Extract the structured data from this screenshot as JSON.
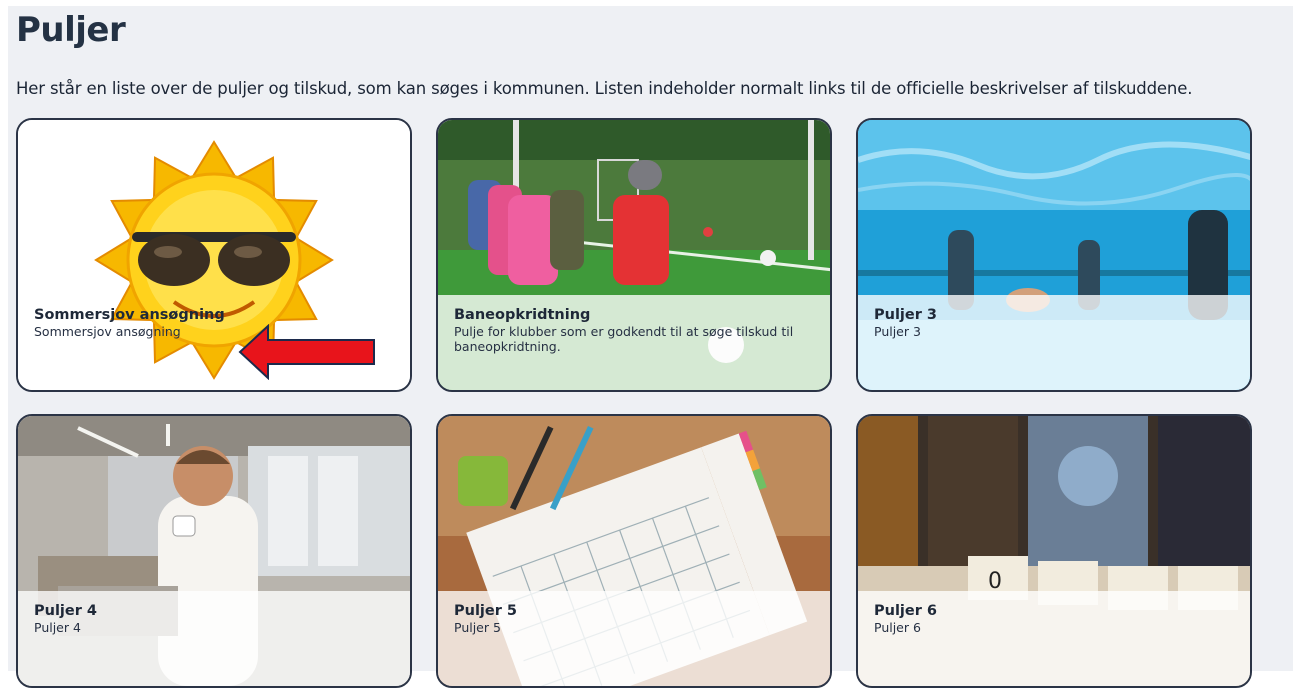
{
  "page": {
    "title": "Puljer",
    "intro": "Her står en liste over de puljer og tilskud, som kan søges i kommunen. Listen indeholder normalt links til de officielle beskrivelser af tilskuddene."
  },
  "cards": [
    {
      "title": "Sommersjov ansøgning",
      "desc": "Sommersjov ansøgning",
      "image": "sun-with-sunglasses"
    },
    {
      "title": "Baneopkridtning",
      "desc": "Pulje for klubber som er godkendt til at søge tilskud til baneopkridtning.",
      "image": "children-playing-football"
    },
    {
      "title": "Puljer 3",
      "desc": "Puljer 3",
      "image": "underwater-swimming-pool"
    },
    {
      "title": "Puljer 4",
      "desc": "Puljer 4",
      "image": "man-with-coffee-at-laptop"
    },
    {
      "title": "Puljer 5",
      "desc": "Puljer 5",
      "image": "calendar-planner-on-desk"
    },
    {
      "title": "Puljer 6",
      "desc": "Puljer 6",
      "image": "record-store-shelves"
    }
  ],
  "annotation": {
    "type": "red-arrow-pointing-left",
    "color": "#e8141b"
  }
}
